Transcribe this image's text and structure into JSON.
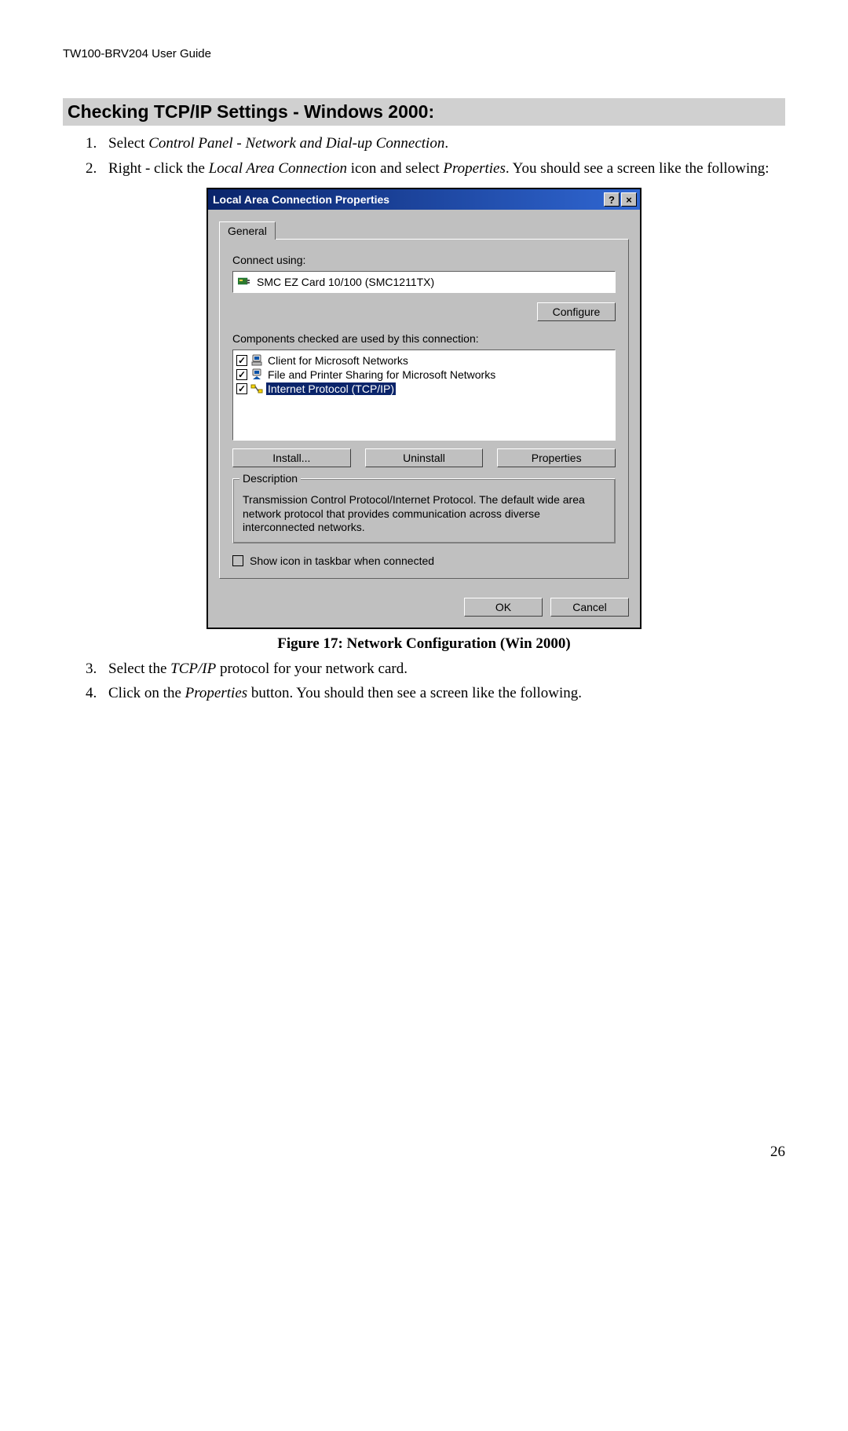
{
  "header": "TW100-BRV204 User Guide",
  "section_title": "Checking TCP/IP Settings - Windows 2000:",
  "steps_a": {
    "s1a": "Select ",
    "s1b": "Control Panel - Network and Dial-up Connection",
    "s1c": ".",
    "s2a": "Right - click the ",
    "s2b": "Local Area Connection",
    "s2c": " icon and select ",
    "s2d": "Properties",
    "s2e": ". You should see a screen like the following:"
  },
  "dialog": {
    "title": "Local Area Connection Properties",
    "help": "?",
    "close": "×",
    "tab_general": "General",
    "connect_using_label": "Connect using:",
    "nic": "SMC EZ Card 10/100 (SMC1211TX)",
    "configure": "Configure",
    "components_label": "Components checked are used by this connection:",
    "components": [
      {
        "label": "Client for Microsoft Networks",
        "checked": true,
        "selected": false
      },
      {
        "label": "File and Printer Sharing for Microsoft Networks",
        "checked": true,
        "selected": false
      },
      {
        "label": "Internet Protocol (TCP/IP)",
        "checked": true,
        "selected": true
      }
    ],
    "install": "Install...",
    "uninstall": "Uninstall",
    "properties": "Properties",
    "desc_title": "Description",
    "desc_text": "Transmission Control Protocol/Internet Protocol. The default wide area network protocol that provides communication across diverse interconnected networks.",
    "show_icon": "Show icon in taskbar when connected",
    "ok": "OK",
    "cancel": "Cancel"
  },
  "figure_caption": "Figure 17: Network Configuration (Win 2000)",
  "steps_b": {
    "s3a": "Select the ",
    "s3b": "TCP/IP",
    "s3c": " protocol for your network card.",
    "s4a": "Click on the ",
    "s4b": "Properties",
    "s4c": " button. You should then see a screen like the following."
  },
  "page_number": "26"
}
